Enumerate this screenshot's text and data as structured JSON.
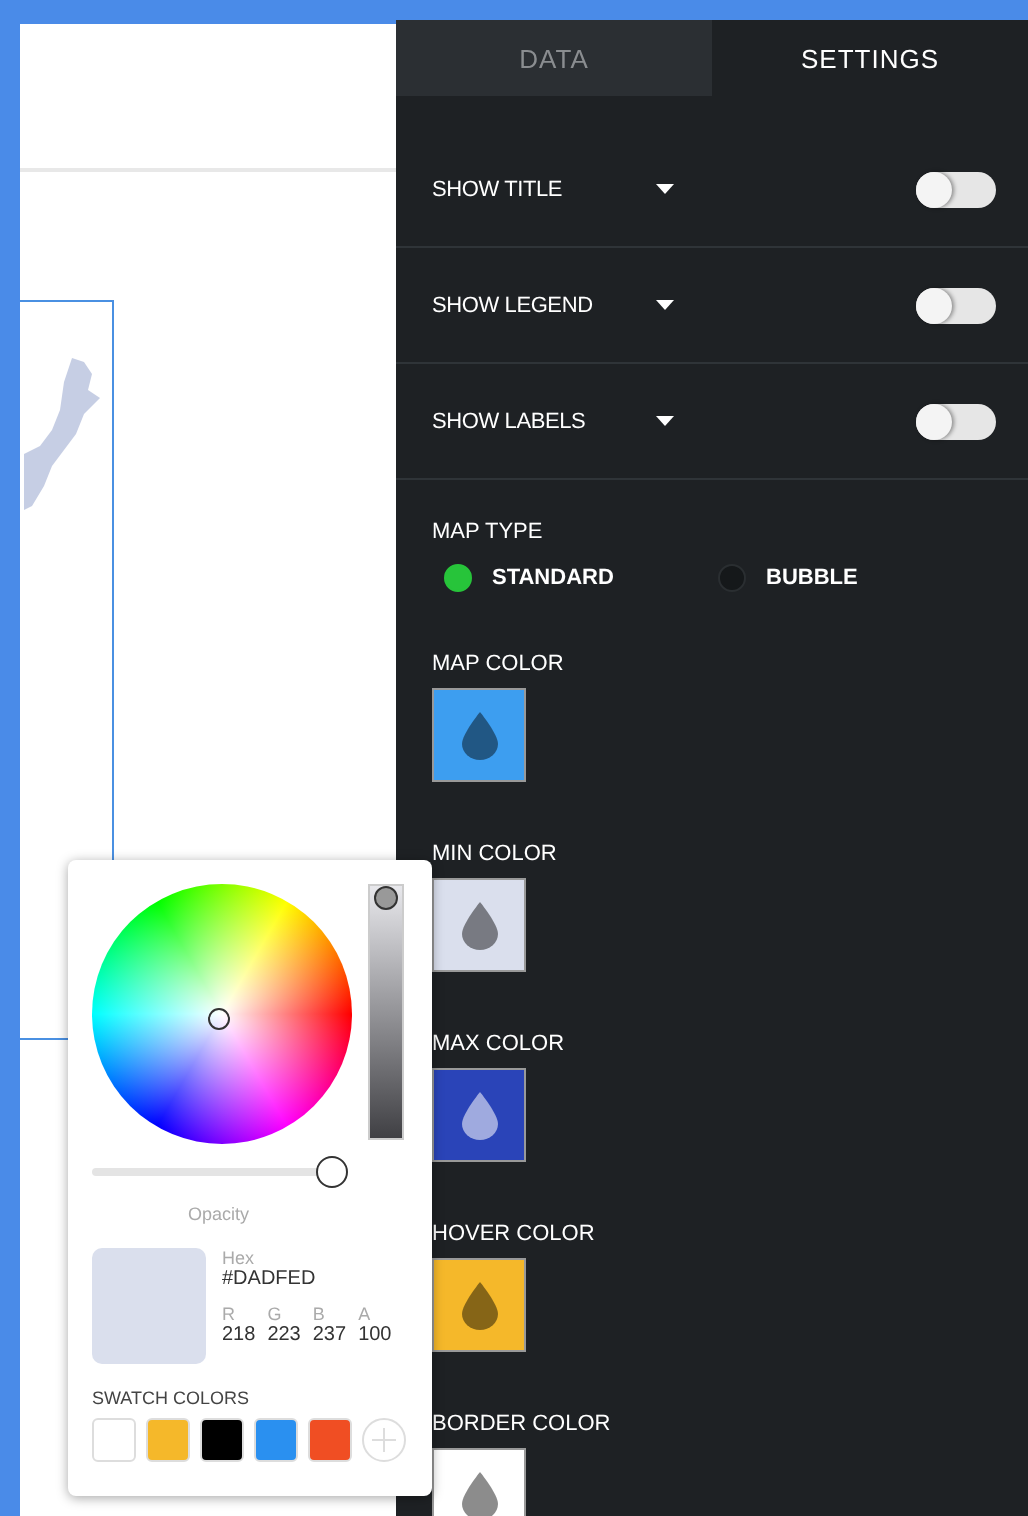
{
  "tabs": [
    {
      "label": "DATA",
      "selected": false
    },
    {
      "label": "SETTINGS",
      "selected": true
    }
  ],
  "toggles": [
    {
      "label": "SHOW TITLE",
      "on": false
    },
    {
      "label": "SHOW LEGEND",
      "on": false
    },
    {
      "label": "SHOW LABELS",
      "on": false
    }
  ],
  "map_type": {
    "label": "MAP TYPE",
    "options": [
      {
        "label": "STANDARD",
        "selected": true
      },
      {
        "label": "BUBBLE",
        "selected": false
      }
    ]
  },
  "colors": [
    {
      "label": "MAP COLOR",
      "color": "#3d9ef0"
    },
    {
      "label": "MIN COLOR",
      "color": "#dadfed"
    },
    {
      "label": "MAX COLOR",
      "color": "#2a44b8"
    },
    {
      "label": "HOVER COLOR",
      "color": "#f5b82a"
    },
    {
      "label": "BORDER COLOR",
      "color": "#ffffff"
    }
  ],
  "color_picker": {
    "brightness": {
      "level": 1
    },
    "opacity": {
      "label": "Opacity",
      "level": 1
    },
    "hex_label": "Hex",
    "hex_value": "#DADFED",
    "channels": [
      {
        "label": "R",
        "value": "218"
      },
      {
        "label": "G",
        "value": "223"
      },
      {
        "label": "B",
        "value": "237"
      },
      {
        "label": "A",
        "value": "100"
      }
    ],
    "swatch_label": "SWATCH COLORS",
    "swatches": [
      {
        "color": "#ffffff"
      },
      {
        "color": "#f5b82a"
      },
      {
        "color": "#000000"
      },
      {
        "color": "#2a90f0"
      },
      {
        "color": "#f04e23"
      }
    ]
  }
}
